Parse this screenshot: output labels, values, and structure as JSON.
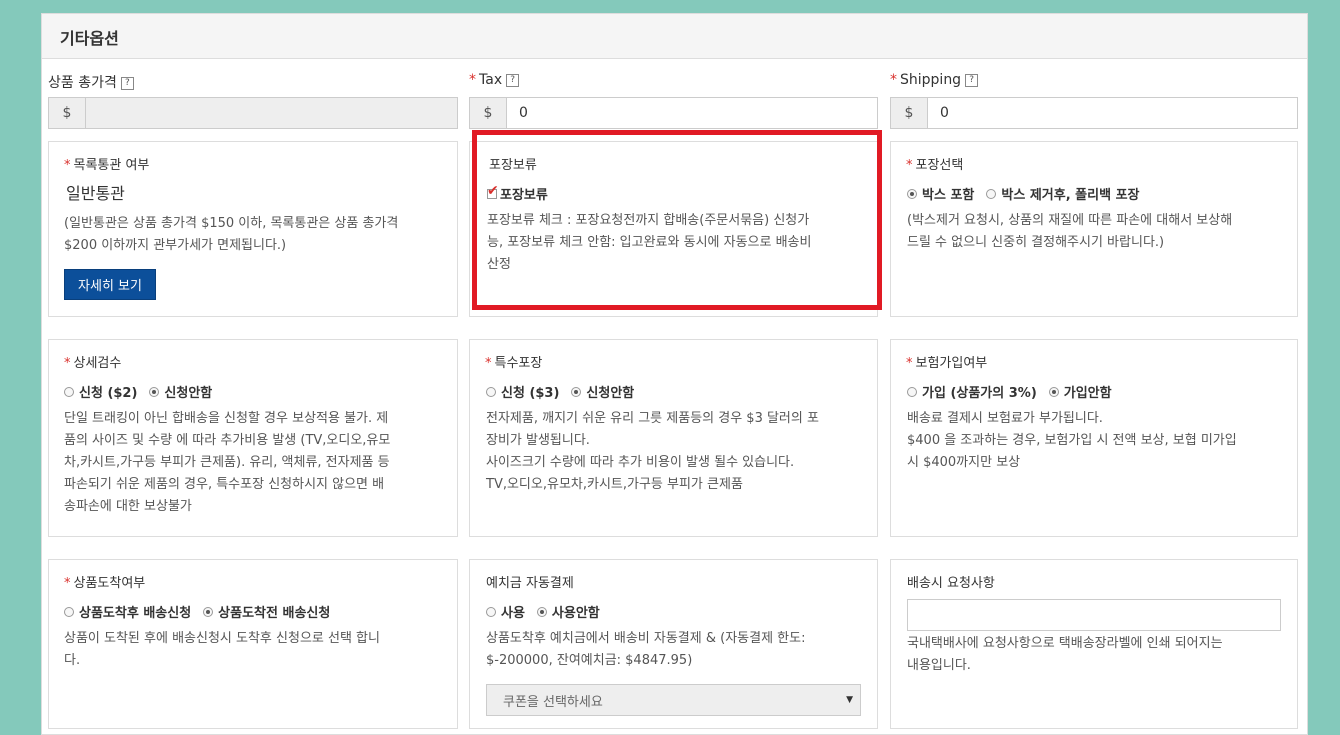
{
  "panel": {
    "title": "기타옵션"
  },
  "fields": {
    "total_price": {
      "label": "상품 총가격",
      "help": "?",
      "addon": "$",
      "value": ""
    },
    "tax": {
      "required": "*",
      "label": "Tax",
      "help": "?",
      "addon": "$",
      "value": "0"
    },
    "shipping": {
      "required": "*",
      "label": "Shipping",
      "help": "?",
      "addon": "$",
      "value": "0"
    }
  },
  "customs": {
    "required": "*",
    "title": "목록통관 여부",
    "value": "일반통관",
    "desc_line1": "(일반통관은 상품 총가격 $150 이하, 목록통관은 상품 총가격",
    "desc_line2": "$200 이하까지 관부가세가 면제됩니다.)",
    "button": "자세히 보기"
  },
  "hold": {
    "title": "포장보류",
    "checkbox_label": "포장보류",
    "checked": true,
    "desc_line1": "포장보류 체크 : 포장요청전까지 합배송(주문서묶음) 신청가",
    "desc_line2": "능, 포장보류 체크 안함: 입고완료와 동시에 자동으로 배송비",
    "desc_line3": "산정"
  },
  "packing": {
    "required": "*",
    "title": "포장선택",
    "opt1": "박스 포함",
    "opt2": "박스 제거후, 폴리백 포장",
    "selected": 1,
    "desc_line1": "(박스제거 요청시, 상품의 재질에 따른 파손에 대해서 보상해",
    "desc_line2": "드릴 수 없으니 신중히 결정해주시기 바랍니다.)"
  },
  "inspection": {
    "required": "*",
    "title": "상세검수",
    "opt1": "신청 ($2)",
    "opt2": "신청안함",
    "selected": 2,
    "desc_line1": "단일 트래킹이 아닌 합배송을 신청할 경우 보상적용 불가. 제",
    "desc_line2": "품의 사이즈 및 수량 에 따라 추가비용 발생 (TV,오디오,유모",
    "desc_line3": "차,카시트,가구등 부피가 큰제품). 유리, 액체류, 전자제품 등",
    "desc_line4": "파손되기 쉬운 제품의 경우, 특수포장 신청하시지 않으면 배",
    "desc_line5": "송파손에 대한 보상불가"
  },
  "special": {
    "required": "*",
    "title": "특수포장",
    "opt1": "신청 ($3)",
    "opt2": "신청안함",
    "selected": 2,
    "desc_line1": "전자제품, 깨지기 쉬운 유리 그릇 제품등의 경우 $3 달러의 포",
    "desc_line2": "장비가 발생됩니다.",
    "desc_line3": "사이즈크기 수량에 따라 추가 비용이 발생 될수 있습니다.",
    "desc_line4": "TV,오디오,유모차,카시트,가구등 부피가 큰제품"
  },
  "insurance": {
    "required": "*",
    "title": "보험가입여부",
    "opt1": "가입 (상품가의 3%)",
    "opt2": "가입안함",
    "selected": 2,
    "desc_line1": "배송료 결제시 보험료가 부가됩니다.",
    "desc_line2": "$400 을 조과하는 경우, 보험가입 시 전액 보상, 보협 미가입",
    "desc_line3": "시 $400까지만 보상"
  },
  "arrival": {
    "required": "*",
    "title": "상품도착여부",
    "opt1": "상품도착후 배송신청",
    "opt2": "상품도착전 배송신청",
    "selected": 2,
    "desc_line1": "상품이 도착된 후에 배송신청시 도착후 신청으로 선택 합니",
    "desc_line2": "다."
  },
  "deposit": {
    "title": "예치금 자동결제",
    "opt1": "사용",
    "opt2": "사용안함",
    "selected": 2,
    "desc_line1": "상품도착후 예치금에서 배송비 자동결제 & (자동결제 한도:",
    "desc_line2": "$-200000, 잔여예치금: $4847.95)",
    "coupon_placeholder": "쿠폰을 선택하세요"
  },
  "request": {
    "title": "배송시 요청사항",
    "value": "",
    "desc_line1": "국내택배사에 요청사항으로 택배송장라벨에 인쇄 되어지는",
    "desc_line2": "내용입니다."
  },
  "colors": {
    "accent": "#0c4f9a",
    "highlight": "#e11a24",
    "background": "#84c9bb",
    "required": "#d9302c"
  }
}
